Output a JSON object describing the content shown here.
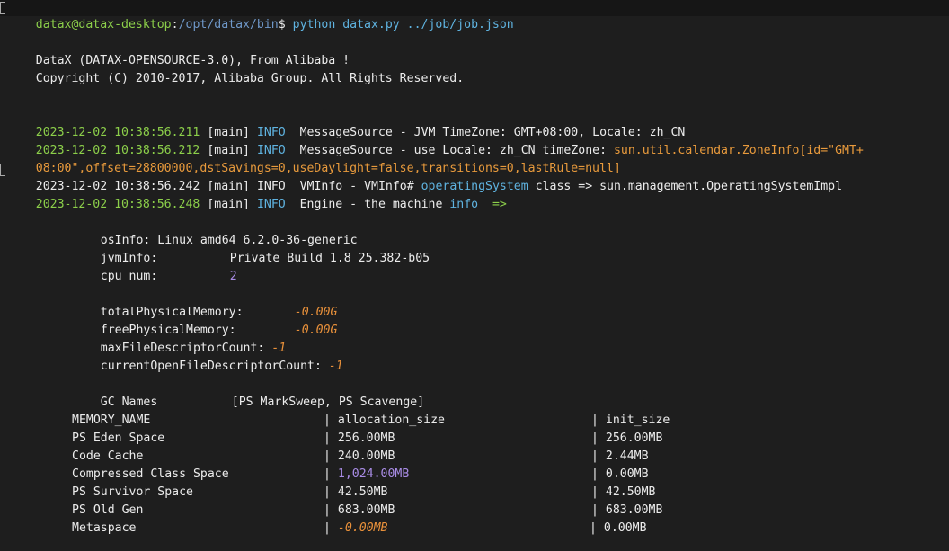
{
  "prompt": {
    "userhost": "datax@datax-desktop",
    "sep": ":",
    "path": "/opt/datax/bin",
    "symbol": "$ ",
    "command": "python datax.py ../job/job.json"
  },
  "banner": {
    "line1": "DataX (DATAX-OPENSOURCE-3.0), From Alibaba !",
    "line2": "Copyright (C) 2010-2017, Alibaba Group. All Rights Reserved."
  },
  "logs": [
    {
      "ts": "2023-12-02 10:38:56.211",
      "thread": "[main]",
      "level": "INFO",
      "source": "MessageSource",
      "dash": " - ",
      "text": "JVM TimeZone: GMT+08:00, Locale: zh_CN"
    },
    {
      "ts": "2023-12-02 10:38:56.212",
      "thread": "[main]",
      "level": "INFO",
      "source": "MessageSource",
      "dash": " - ",
      "text_a": "use Locale: zh_CN timeZone: ",
      "text_b": "sun.util.calendar.ZoneInfo[id=\"GMT+",
      "cont": "08:00\",offset=28800000,dstSavings=0,useDaylight=false,transitions=0,lastRule=null]"
    },
    {
      "ts": "2023-12-02 10:38:56.242",
      "thread": "[main]",
      "level": "INFO",
      "source": "VMInfo",
      "dash": " - ",
      "text_a": "VMInfo# ",
      "text_b": "operatingSystem",
      "text_c": " class => sun.management.OperatingSystemImpl"
    },
    {
      "ts": "2023-12-02 10:38:56.248",
      "thread": "[main]",
      "level": "INFO",
      "source": "Engine",
      "dash": " - ",
      "text_a": "the machine ",
      "text_b": "info",
      "text_c": "  =>"
    }
  ],
  "sysinfo": {
    "os_label": "osInfo:",
    "os_value": " Linux amd64 6.2.0-36-generic",
    "jvm_label": "jvmInfo:",
    "jvm_value": "Private Build 1.8 25.382-b05",
    "cpu_label": "cpu num:",
    "cpu_value": "2",
    "tpm_label": "totalPhysicalMemory:",
    "tpm_value": "-0.00G",
    "fpm_label": "freePhysicalMemory:",
    "fpm_value": "-0.00G",
    "mfd_label": "maxFileDescriptorCount:",
    "mfd_value": "-1",
    "cofd_label": "currentOpenFileDescriptorCount:",
    "cofd_value": "-1",
    "gc_label": "GC Names",
    "gc_value": "[PS MarkSweep, PS Scavenge]"
  },
  "memory_table": {
    "headers": [
      "MEMORY_NAME",
      "allocation_size",
      "init_size"
    ],
    "rows": [
      [
        "PS Eden Space",
        "256.00MB",
        "256.00MB"
      ],
      [
        "Code Cache",
        "240.00MB",
        "2.44MB"
      ],
      [
        "Compressed Class Space",
        "1,024.00MB",
        "0.00MB"
      ],
      [
        "PS Survivor Space",
        "42.50MB",
        "42.50MB"
      ],
      [
        "PS Old Gen",
        "683.00MB",
        "683.00MB"
      ],
      [
        "Metaspace",
        "-0.00MB",
        "0.00MB"
      ]
    ]
  },
  "colors": {
    "background": "#1e1e1e",
    "prompt_green": "#8ccf4a",
    "path_blue": "#6f98c9",
    "info_blue": "#5fb3e0",
    "number_purple": "#a98ce6",
    "keyword_orange": "#e89a3c"
  }
}
